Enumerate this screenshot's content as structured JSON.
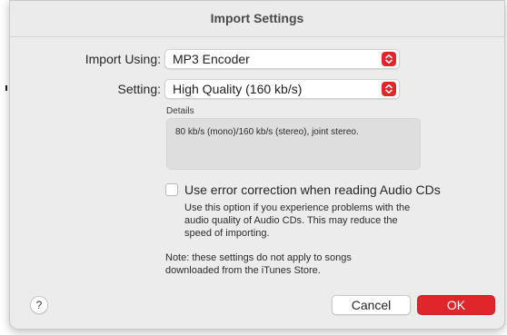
{
  "dialog": {
    "title": "Import Settings",
    "accent_color": "#e0262a"
  },
  "import_using": {
    "label": "Import Using:",
    "value": "MP3 Encoder",
    "icon": "chevron-up-down-icon"
  },
  "setting": {
    "label": "Setting:",
    "value": "High Quality (160 kb/s)",
    "icon": "chevron-up-down-icon"
  },
  "details": {
    "label": "Details",
    "text": "80 kb/s (mono)/160 kb/s (stereo), joint stereo."
  },
  "error_correction": {
    "checked": false,
    "label": "Use error correction when reading Audio CDs",
    "help_line1": "Use this option if you experience problems with the",
    "help_line2": "audio quality of Audio CDs. This may reduce the",
    "help_line3": "speed of importing."
  },
  "note": {
    "line1": "Note: these settings do not apply to songs",
    "line2": "downloaded from the iTunes Store."
  },
  "footer": {
    "help_label": "?",
    "cancel_label": "Cancel",
    "ok_label": "OK"
  }
}
